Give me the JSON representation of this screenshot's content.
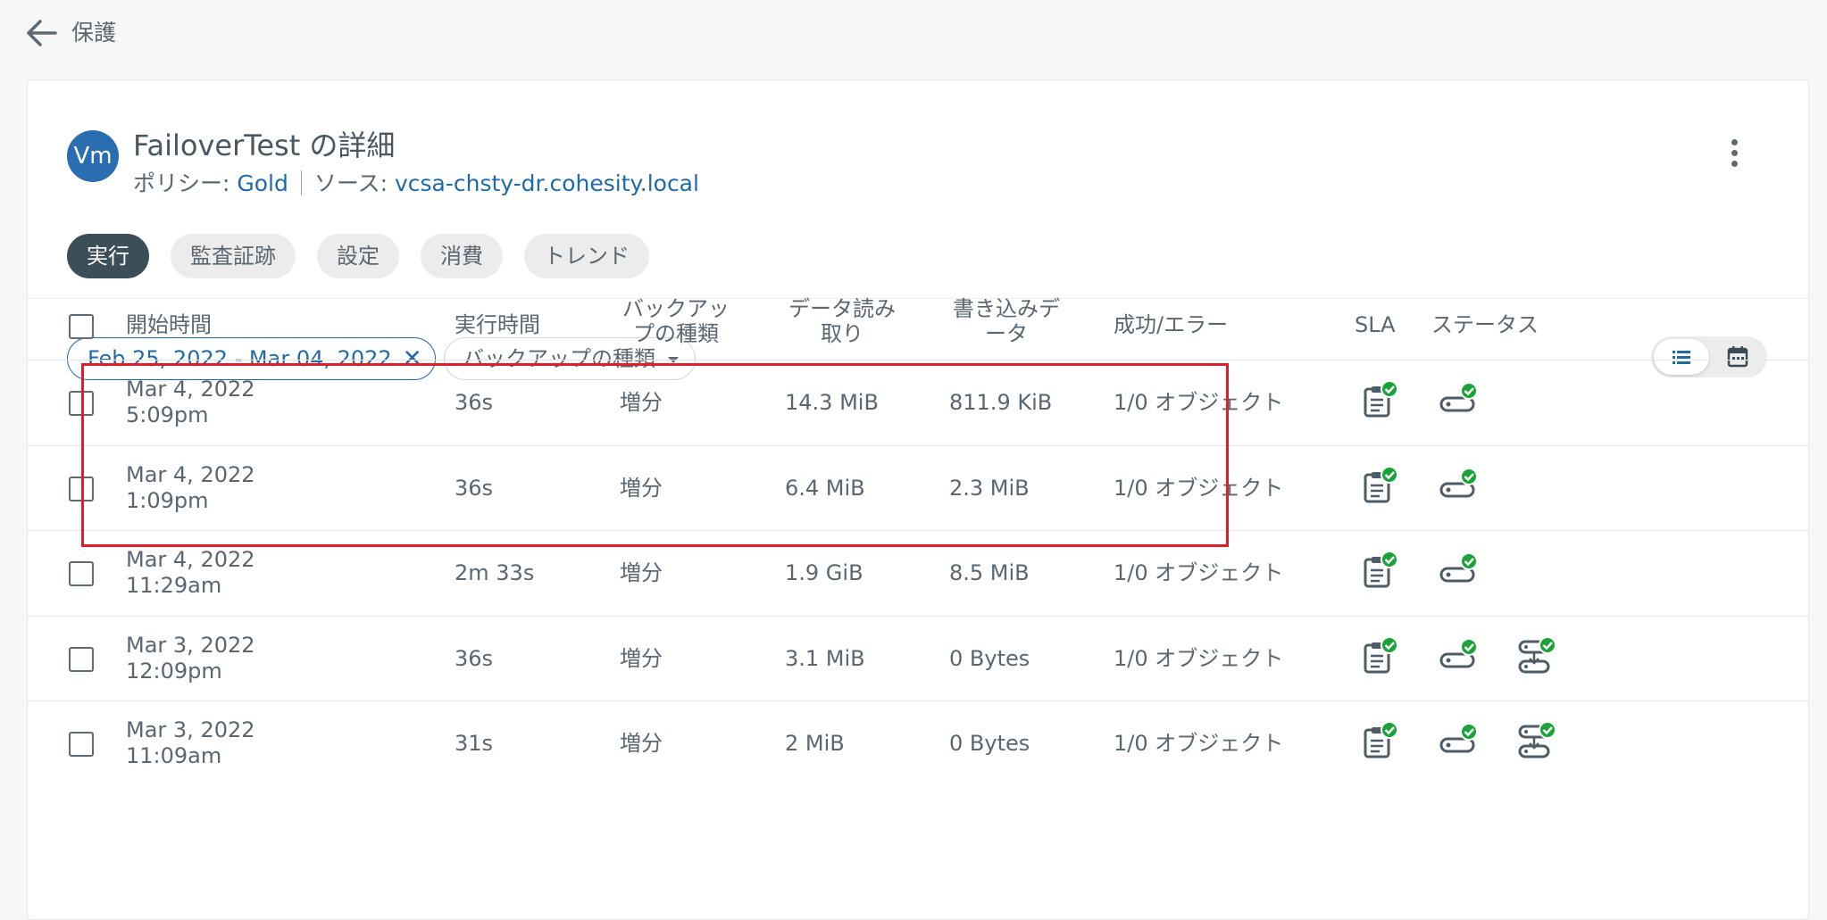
{
  "nav": {
    "back_label": "保護"
  },
  "header": {
    "avatar_text": "Vm",
    "title": "FailoverTest の詳細",
    "policy_label": "ポリシー: ",
    "policy_value": "Gold",
    "source_label": "ソース: ",
    "source_value": "vcsa-chsty-dr.cohesity.local"
  },
  "tabs": [
    {
      "label": "実行",
      "active": true
    },
    {
      "label": "監査証跡"
    },
    {
      "label": "設定"
    },
    {
      "label": "消費"
    },
    {
      "label": "トレンド"
    }
  ],
  "filters": {
    "date_range": "Feb 25, 2022 - Mar 04, 2022",
    "backup_type_dropdown": "バックアップの種類"
  },
  "table": {
    "headers": {
      "start_time": "開始時間",
      "duration": "実行時間",
      "backup_type": [
        "バックアッ",
        "プの種類"
      ],
      "data_read": [
        "データ読み",
        "取り"
      ],
      "data_written": [
        "書き込みデ",
        "ータ"
      ],
      "success_error": "成功/エラー",
      "sla": "SLA",
      "status": "ステータス"
    },
    "rows": [
      {
        "date": "Mar 4, 2022",
        "time": "5:09pm",
        "duration": "36s",
        "type": "増分",
        "read": "14.3 MiB",
        "written": "811.9 KiB",
        "result": "1/0 オブジェクト",
        "replication": false
      },
      {
        "date": "Mar 4, 2022",
        "time": "1:09pm",
        "duration": "36s",
        "type": "増分",
        "read": "6.4 MiB",
        "written": "2.3 MiB",
        "result": "1/0 オブジェクト",
        "replication": false
      },
      {
        "date": "Mar 4, 2022",
        "time": "11:29am",
        "duration": "2m 33s",
        "type": "増分",
        "read": "1.9 GiB",
        "written": "8.5 MiB",
        "result": "1/0 オブジェクト",
        "replication": false
      },
      {
        "date": "Mar 3, 2022",
        "time": "12:09pm",
        "duration": "36s",
        "type": "増分",
        "read": "3.1 MiB",
        "written": "0 Bytes",
        "result": "1/0 オブジェクト",
        "replication": true
      },
      {
        "date": "Mar 3, 2022",
        "time": "11:09am",
        "duration": "31s",
        "type": "増分",
        "read": "2 MiB",
        "written": "0 Bytes",
        "result": "1/0 オブジェクト",
        "replication": true
      }
    ]
  },
  "icons": {
    "sla": "sla-met-icon",
    "status": "backup-success-icon",
    "replication": "replication-success-icon"
  },
  "colors": {
    "accent": "#1f6aa8",
    "success": "#1aa33a",
    "active_tab": "#3c4e58",
    "highlight": "#e01e2b"
  }
}
